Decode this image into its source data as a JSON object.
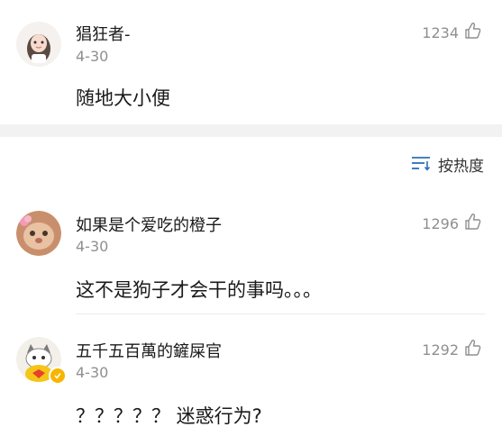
{
  "comments": [
    {
      "username": "猖狂者-",
      "date": "4-30",
      "text": "随地大小便",
      "likes": "1234"
    },
    {
      "username": "如果是个爱吃的橙子",
      "date": "4-30",
      "text": "这不是狗子才会干的事吗。。。",
      "likes": "1296"
    },
    {
      "username": "五千五百萬的鏟屎官",
      "date": "4-30",
      "text": "？？？？？ 迷惑行为?",
      "likes": "1292"
    }
  ],
  "sort": {
    "label": "按热度",
    "icon": "sort-lines-icon"
  },
  "colors": {
    "text": "#1a1a1a",
    "muted": "#8f8f8f",
    "band": "#f2f2f2",
    "verified": "#f7b500"
  }
}
